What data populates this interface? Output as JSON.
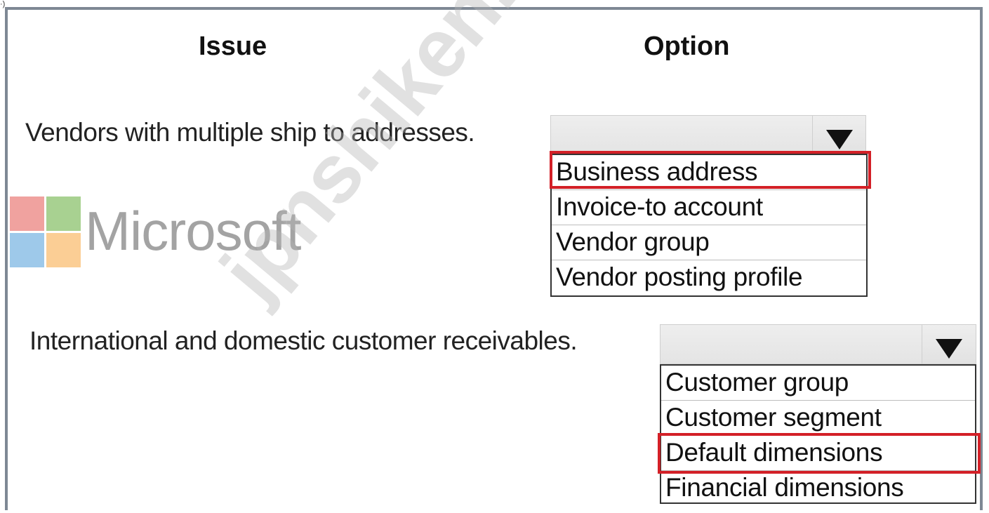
{
  "headers": {
    "issue": "Issue",
    "option": "Option"
  },
  "questions": [
    {
      "issue": "Vendors with multiple ship to addresses.",
      "selected": "",
      "options": [
        "Business address",
        "Invoice-to account",
        "Vendor group",
        "Vendor posting profile"
      ],
      "highlighted_option": "Business address"
    },
    {
      "issue": "International and domestic customer receivables.",
      "selected": "",
      "options": [
        "Customer group",
        "Customer segment",
        "Default dimensions",
        "Financial dimensions"
      ],
      "highlighted_option": "Default dimensions"
    }
  ],
  "logo": {
    "text": "Microsoft",
    "colors": [
      "#f0a29f",
      "#a8d191",
      "#9ec9ea",
      "#fbce95"
    ]
  },
  "watermark": "jpnshiken.com",
  "corner_mark": "·)",
  "colors": {
    "highlight": "#d32027",
    "frame": "#7e8894"
  }
}
